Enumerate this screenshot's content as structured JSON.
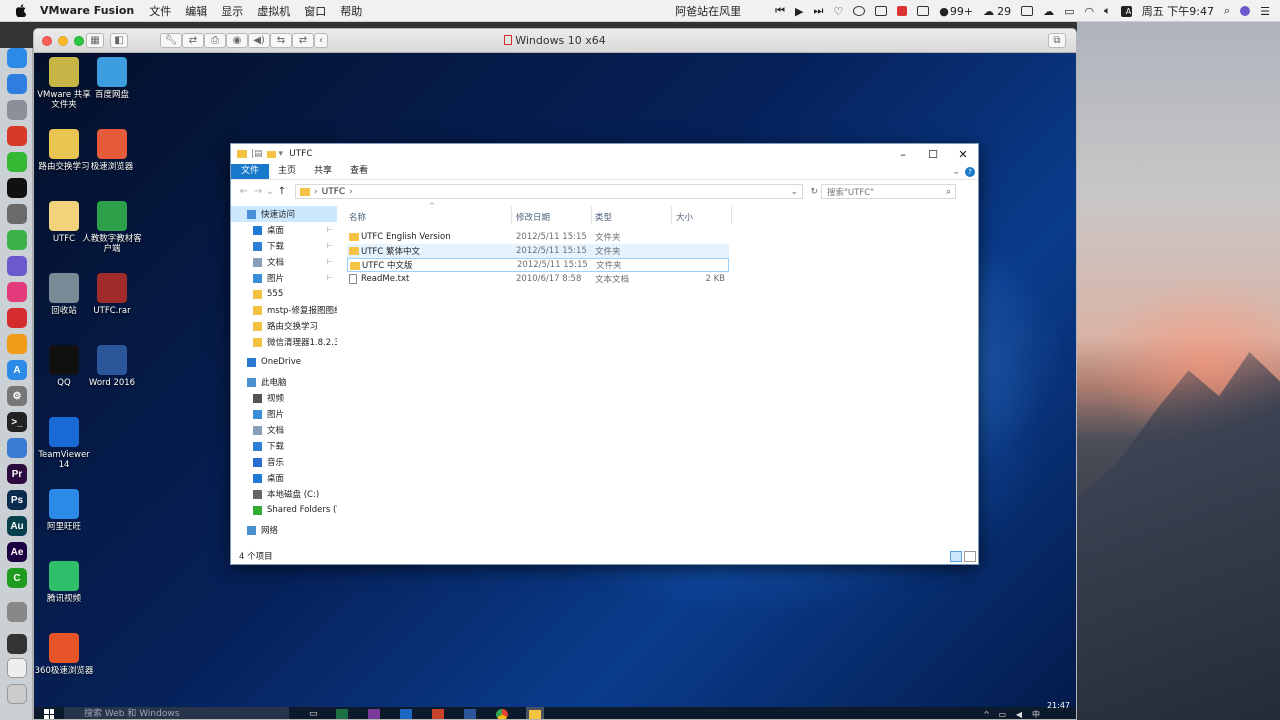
{
  "mac_menubar": {
    "app_name": "VMware Fusion",
    "menus": [
      "文件",
      "编辑",
      "显示",
      "虚拟机",
      "窗口",
      "帮助"
    ],
    "now_playing": "阿爸站在风里",
    "badge_count": "99+",
    "temperature": "29",
    "datetime": "周五 下午9:47"
  },
  "vmware": {
    "window_title": "Windows 10 x64"
  },
  "dock": {
    "items": [
      "finder",
      "safari",
      "launchpad",
      "xmind",
      "wechat",
      "qq",
      "photos",
      "facetime",
      "siri",
      "itunes",
      "netease-music",
      "books",
      "app-store",
      "system-preferences",
      "terminal",
      "preview",
      "premiere",
      "photoshop",
      "audition",
      "after-effects",
      "camtasia",
      "vmware",
      "terminal-2",
      "textedit",
      "trash"
    ]
  },
  "desktop_icons": [
    {
      "label": "VMware 共享文件夹"
    },
    {
      "label": "百度网盘"
    },
    {
      "label": "路由交换学习"
    },
    {
      "label": "极速浏览器"
    },
    {
      "label": "UTFC"
    },
    {
      "label": "人教数字教材客户端"
    },
    {
      "label": "回收站"
    },
    {
      "label": "UTFC.rar"
    },
    {
      "label": "QQ"
    },
    {
      "label": "Word 2016"
    },
    {
      "label": "TeamViewer 14"
    },
    {
      "label": "阿里旺旺"
    },
    {
      "label": "腾讯视频"
    },
    {
      "label": "360极速浏览器"
    }
  ],
  "taskbar": {
    "search_placeholder": "搜索 Web 和 Windows",
    "time": "21:47",
    "ime": "中"
  },
  "explorer": {
    "title": "UTFC",
    "ribbon_tabs": [
      "文件",
      "主页",
      "共享",
      "查看"
    ],
    "breadcrumb": "UTFC",
    "search_placeholder": "搜索\"UTFC\"",
    "nav": {
      "quick_access": "快速访问",
      "pinned": [
        "桌面",
        "下载",
        "文档",
        "图片"
      ],
      "recent": [
        "555",
        "mstp-修复报图图纸",
        "路由交换学习",
        "微信清理器1.8.2.3"
      ],
      "onedrive": "OneDrive",
      "this_pc": "此电脑",
      "pc_items": [
        "视频",
        "图片",
        "文档",
        "下载",
        "音乐",
        "桌面",
        "本地磁盘 (C:)",
        "Shared Folders (\\"
      ],
      "network": "网络"
    },
    "columns": {
      "name": "名称",
      "modified": "修改日期",
      "type": "类型",
      "size": "大小"
    },
    "files": [
      {
        "name": "UTFC English Version",
        "modified": "2012/5/11 15:15",
        "type": "文件夹",
        "size": ""
      },
      {
        "name": "UTFC 繁体中文",
        "modified": "2012/5/11 15:15",
        "type": "文件夹",
        "size": ""
      },
      {
        "name": "UTFC 中文版",
        "modified": "2012/5/11 15:15",
        "type": "文件夹",
        "size": ""
      },
      {
        "name": "ReadMe.txt",
        "modified": "2010/6/17 8:58",
        "type": "文本文档",
        "size": "2 KB"
      }
    ],
    "status": "4 个项目"
  }
}
